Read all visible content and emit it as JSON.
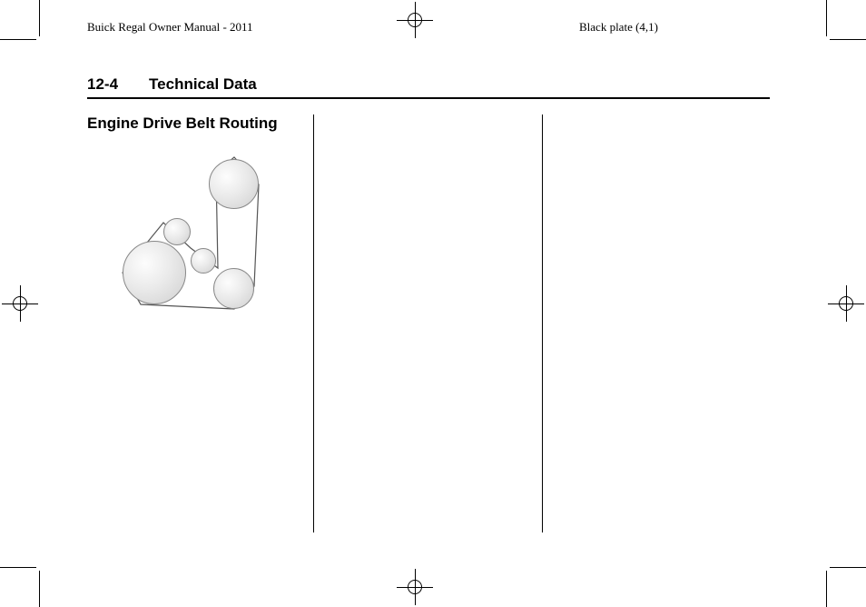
{
  "header": {
    "left_running": "Buick Regal Owner Manual - 2011",
    "right_running": "Black plate (4,1)"
  },
  "section": {
    "page_code": "12-4",
    "title": "Technical Data"
  },
  "content": {
    "subheading": "Engine Drive Belt Routing"
  }
}
